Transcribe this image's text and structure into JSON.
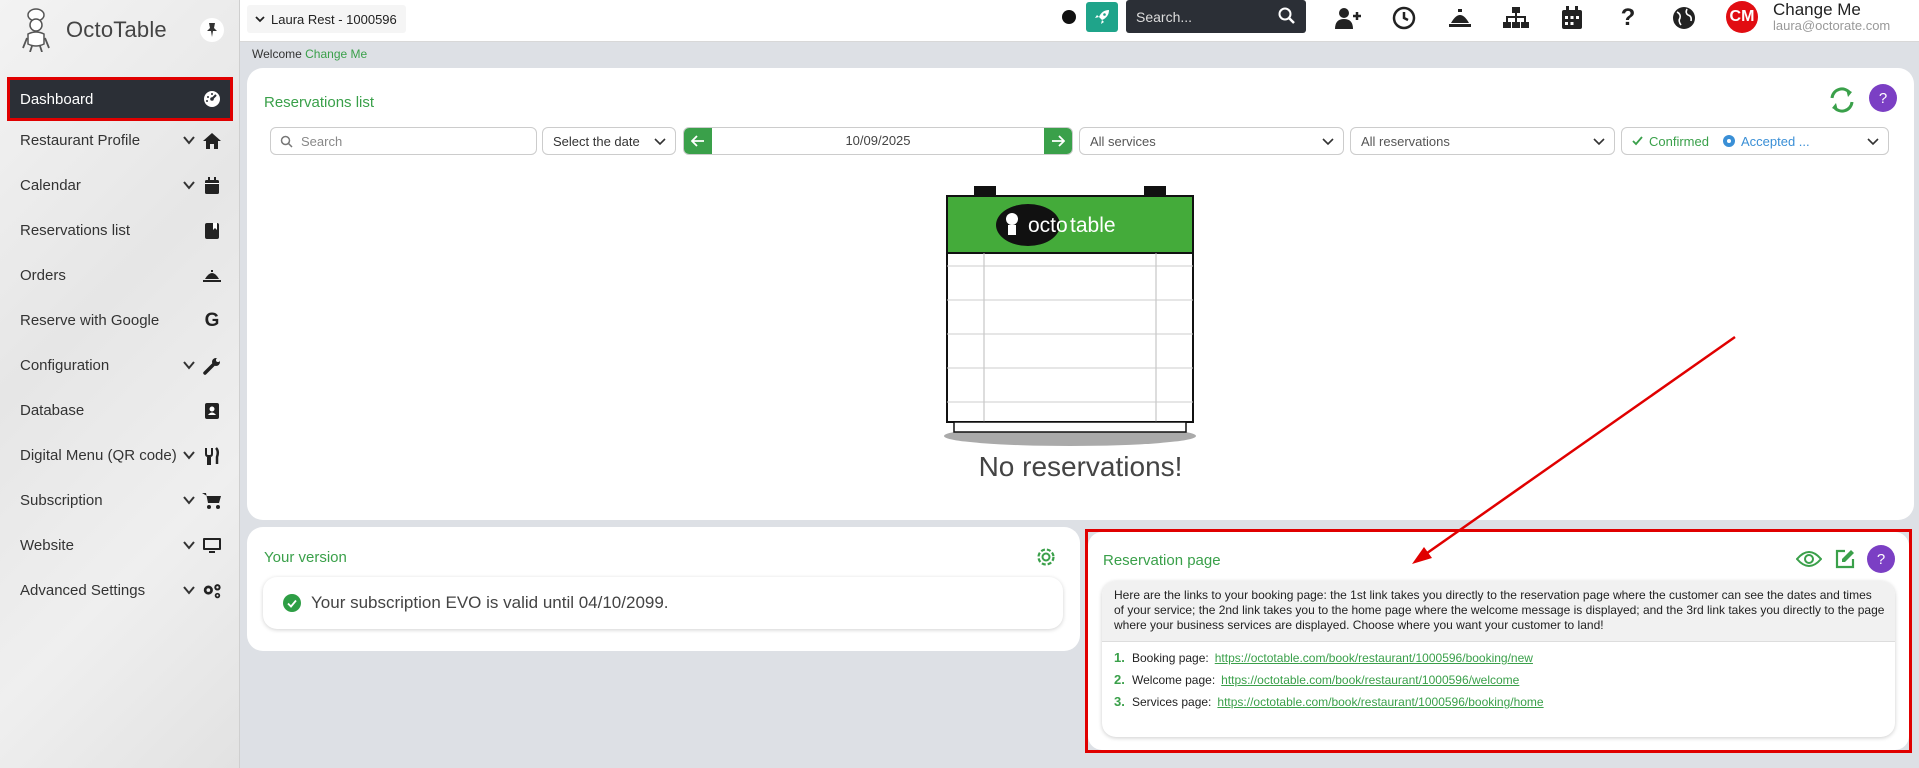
{
  "app": {
    "name": "OctoTable"
  },
  "sidebar": {
    "items": [
      {
        "label": "Dashboard",
        "active": true,
        "expandable": false,
        "icon": "dashboard-gauge-icon"
      },
      {
        "label": "Restaurant Profile",
        "expandable": true,
        "icon": "home-icon"
      },
      {
        "label": "Calendar",
        "expandable": true,
        "icon": "calendar-icon"
      },
      {
        "label": "Reservations list",
        "expandable": false,
        "icon": "book-icon"
      },
      {
        "label": "Orders",
        "expandable": false,
        "icon": "service-bell-icon"
      },
      {
        "label": "Reserve with Google",
        "expandable": false,
        "icon": "google-icon"
      },
      {
        "label": "Configuration",
        "expandable": true,
        "icon": "wrench-icon"
      },
      {
        "label": "Database",
        "expandable": false,
        "icon": "contact-book-icon"
      },
      {
        "label": "Digital Menu (QR code)",
        "expandable": true,
        "icon": "utensils-icon"
      },
      {
        "label": "Subscription",
        "expandable": true,
        "icon": "cart-icon"
      },
      {
        "label": "Website",
        "expandable": true,
        "icon": "monitor-icon"
      },
      {
        "label": "Advanced Settings",
        "expandable": true,
        "icon": "cogs-icon"
      }
    ]
  },
  "topbar": {
    "restaurant": "Laura Rest - 1000596",
    "search_placeholder": "Search...",
    "user_initials": "CM",
    "user_name": "Change Me",
    "user_email": "laura@octorate.com"
  },
  "welcome": {
    "prefix": "Welcome",
    "name": "Change Me"
  },
  "reservations": {
    "title": "Reservations list",
    "search_placeholder": "Search",
    "date_select": "Select the date",
    "date": "10/09/2025",
    "services": "All services",
    "reservations_filter": "All reservations",
    "status_confirmed": "Confirmed",
    "status_accepted": "Accepted ...",
    "empty_message": "No reservations!",
    "logo_text_octo": "octo",
    "logo_text_table": "table"
  },
  "version": {
    "title": "Your version",
    "message": "Your subscription EVO is valid until 04/10/2099."
  },
  "reservation_page": {
    "title": "Reservation page",
    "description": "Here are the links to your booking page: the 1st link takes you directly to the reservation page where the customer can see the dates and times of your service; the 2nd link takes you to the home page where the welcome message is displayed; and the 3rd link takes you directly to the page where your business services are displayed. Choose where you want your customer to land!",
    "links": [
      {
        "num": "1.",
        "label": "Booking page:",
        "url": "https://octotable.com/book/restaurant/1000596/booking/new"
      },
      {
        "num": "2.",
        "label": "Welcome page:",
        "url": "https://octotable.com/book/restaurant/1000596/welcome"
      },
      {
        "num": "3.",
        "label": "Services page:",
        "url": "https://octotable.com/book/restaurant/1000596/booking/home"
      }
    ]
  },
  "colors": {
    "accent_green": "#3aa04a",
    "help_purple": "#7b3fc4",
    "highlight_red": "#e00000",
    "avatar_red": "#e10d12"
  }
}
